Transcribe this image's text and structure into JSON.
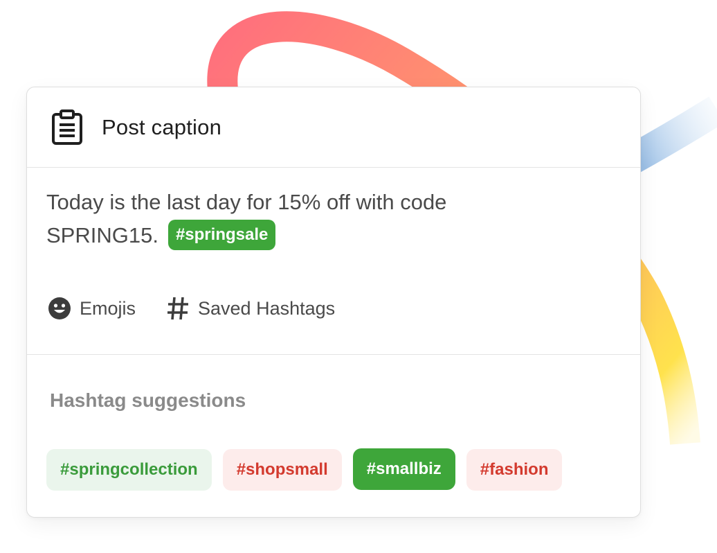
{
  "card": {
    "title": "Post caption",
    "icon": "clipboard-icon"
  },
  "caption": {
    "text": "Today is the last day for 15% off with code SPRING15.",
    "highlight_tag": "#springsale",
    "highlight_color": "#3ea63a"
  },
  "tools": [
    {
      "label": "Emojis",
      "icon": "smiley-icon"
    },
    {
      "label": "Saved Hashtags",
      "icon": "hash-icon"
    }
  ],
  "suggestions": {
    "title": "Hashtag suggestions",
    "chips": [
      {
        "label": "#springcollection",
        "style": "green-soft"
      },
      {
        "label": "#shopsmall",
        "style": "red-soft"
      },
      {
        "label": "#smallbiz",
        "style": "green-solid"
      },
      {
        "label": "#fashion",
        "style": "red-soft"
      }
    ]
  },
  "colors": {
    "green": "#3ea63a",
    "green_soft_bg": "#eaf5ec",
    "red": "#d33a2e",
    "red_soft_bg": "#fdeceb",
    "arc_start": "#ff6f7d",
    "arc_mid": "#ffb35c",
    "arc_end": "#ffe24d",
    "blue_stroke": "#a9c9ea"
  }
}
